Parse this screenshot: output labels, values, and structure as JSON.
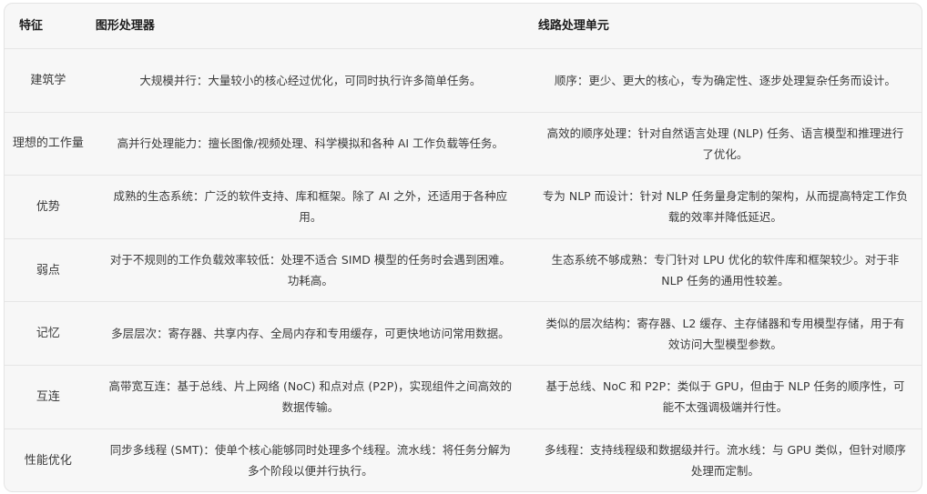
{
  "table": {
    "headers": [
      "特征",
      "图形处理器",
      "线路处理单元"
    ],
    "rows": [
      [
        "建筑学",
        "大规模并行：大量较小的核心经过优化，可同时执行许多简单任务。",
        "顺序：更少、更大的核心，专为确定性、逐步处理复杂任务而设计。"
      ],
      [
        "理想的工作量",
        "高并行处理能力：擅长图像/视频处理、科学模拟和各种 AI 工作负载等任务。",
        "高效的顺序处理：针对自然语言处理 (NLP) 任务、语言模型和推理进行了优化。"
      ],
      [
        "优势",
        "成熟的生态系统：广泛的软件支持、库和框架。除了 AI 之外，还适用于各种应用。",
        "专为 NLP 而设计：针对 NLP 任务量身定制的架构，从而提高特定工作负载的效率并降低延迟。"
      ],
      [
        "弱点",
        "对于不规则的工作负载效率较低：处理不适合 SIMD 模型的任务时会遇到困难。功耗高。",
        "生态系统不够成熟：专门针对 LPU 优化的软件库和框架较少。对于非 NLP 任务的通用性较差。"
      ],
      [
        "记忆",
        "多层层次：寄存器、共享内存、全局内存和专用缓存，可更快地访问常用数据。",
        "类似的层次结构：寄存器、L2 缓存、主存储器和专用模型存储，用于有效访问大型模型参数。"
      ],
      [
        "互连",
        "高带宽互连：基于总线、片上网络 (NoC) 和点对点 (P2P)，实现组件之间高效的数据传输。",
        "基于总线、NoC 和 P2P：类似于 GPU，但由于 NLP 任务的顺序性，可能不太强调极端并行性。"
      ],
      [
        "性能优化",
        "同步多线程 (SMT)：使单个核心能够同时处理多个线程。流水线：将任务分解为多个阶段以便并行执行。",
        "多线程：支持线程级和数据级并行。流水线：与 GPU 类似，但针对顺序处理而定制。"
      ]
    ]
  }
}
